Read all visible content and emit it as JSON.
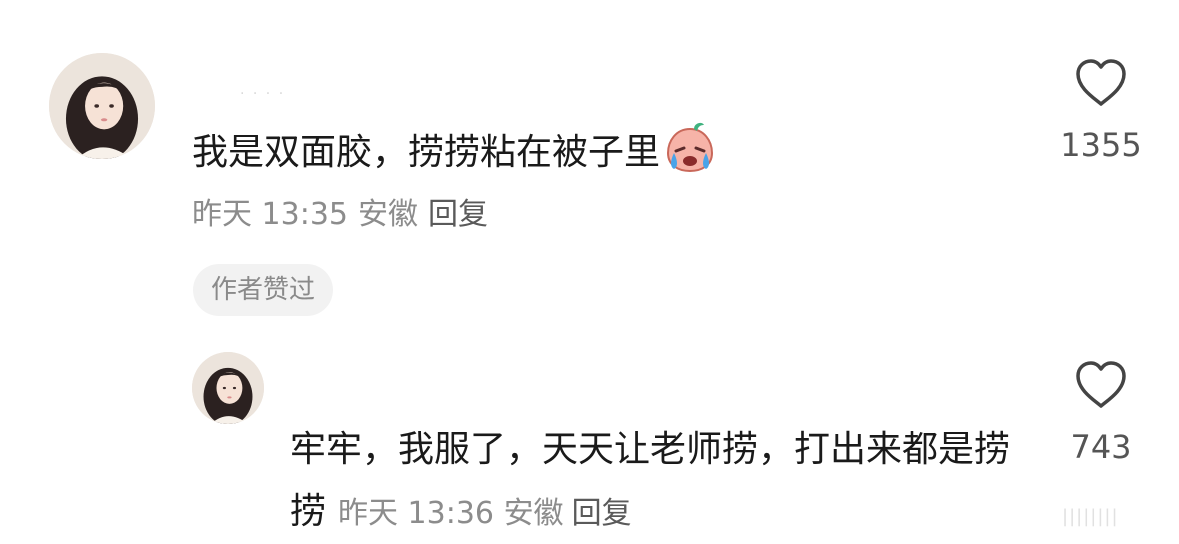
{
  "comment": {
    "username": "· · · ·",
    "text": "我是双面胶，捞捞粘在被子里",
    "emoji": "crying-emoji",
    "time": "昨天 13:35",
    "location": "安徽",
    "reply_label": "回复",
    "badge": "作者赞过",
    "likes": "1355"
  },
  "reply": {
    "text": "牢牢，我服了，天天让老师捞，打出来都是捞捞",
    "time": "昨天 13:36",
    "location": "安徽",
    "reply_label": "回复",
    "likes": "743"
  },
  "colors": {
    "text_primary": "#1a1a1a",
    "text_secondary": "#8c8c8c",
    "badge_bg": "#f2f2f2",
    "heart_stroke": "#444444"
  },
  "watermark": "||||||||"
}
